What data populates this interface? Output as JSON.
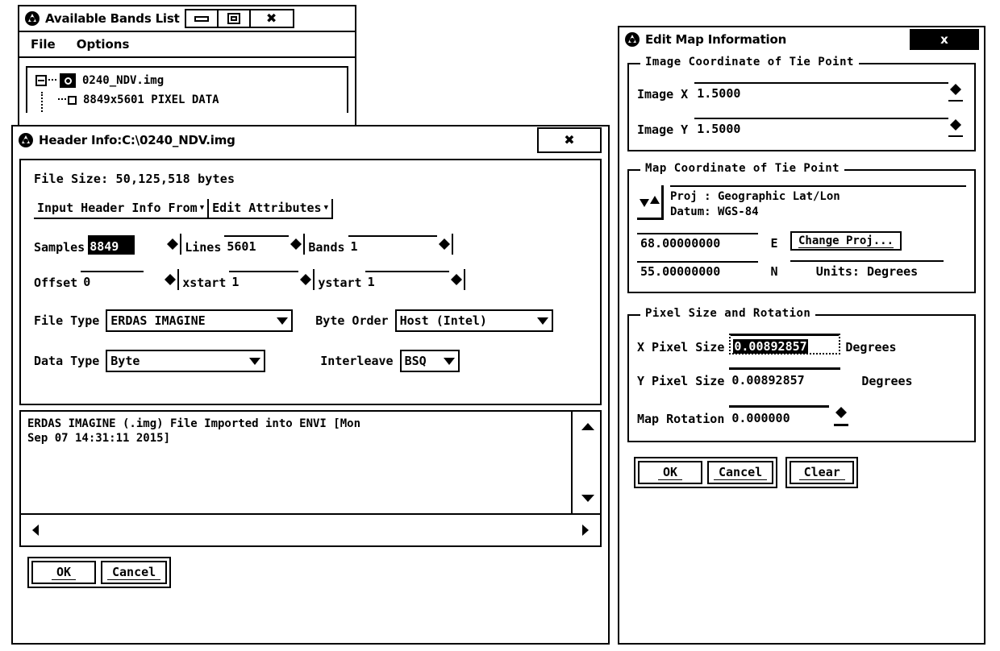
{
  "bands_window": {
    "title": "Available Bands List",
    "logo_icon": "envi-logo-icon",
    "titlebar_buttons": [
      {
        "name": "minimize-button",
        "icon": "minimize-icon"
      },
      {
        "name": "maximize-button",
        "icon": "maximize-icon"
      },
      {
        "name": "close-button",
        "icon": "close-x-icon",
        "label": "✖"
      }
    ],
    "menu": [
      "File",
      "Options"
    ],
    "tree": [
      {
        "label": "0240_NDV.img",
        "level": 0,
        "expander": "collapse-minus-icon",
        "icon": "band-file-icon"
      },
      {
        "label": "8849x5601 PIXEL DATA",
        "level": 1,
        "icon": "band-item-checkbox"
      }
    ]
  },
  "header_window": {
    "title": "Header Info:C:\\0240_NDV.img",
    "logo_icon": "envi-logo-icon",
    "close_label": "✖",
    "file_size": "File Size: 50,125,518 bytes",
    "dropdowns": [
      {
        "label": "Input Header Info From",
        "caret": "▼"
      },
      {
        "label": "Edit Attributes",
        "caret": "▼"
      }
    ],
    "fields": [
      {
        "label": "Samples",
        "value": "8849",
        "selected": true
      },
      {
        "label": "Lines",
        "value": "5601",
        "selected": false
      },
      {
        "label": "Bands",
        "value": "1",
        "selected": false
      },
      {
        "label": "Offset",
        "value": "0",
        "selected": false
      },
      {
        "label": "xstart",
        "value": "1",
        "selected": false
      },
      {
        "label": "ystart",
        "value": "1",
        "selected": false
      }
    ],
    "file_type": {
      "label": "File Type",
      "value": "ERDAS IMAGINE"
    },
    "byte_order": {
      "label": "Byte Order",
      "value": "Host (Intel)"
    },
    "data_type": {
      "label": "Data Type",
      "value": "Byte"
    },
    "interleave": {
      "label": "Interleave",
      "value": "BSQ"
    },
    "description": "ERDAS IMAGINE (.img) File Imported into ENVI [Mon\nSep 07 14:31:11 2015]",
    "buttons": [
      {
        "label": "OK",
        "name": "ok-button"
      },
      {
        "label": "Cancel",
        "name": "cancel-button"
      }
    ]
  },
  "map_window": {
    "title": "Edit Map Information",
    "logo_icon": "envi-logo-icon",
    "close_label": "x",
    "group_image": {
      "legend": "Image Coordinate of Tie Point",
      "fields": [
        {
          "label": "Image X",
          "value": "1.5000"
        },
        {
          "label": "Image Y",
          "value": "1.5000"
        }
      ]
    },
    "group_map": {
      "legend": "Map Coordinate of Tie Point",
      "flip_icon": "up-down-arrows-icon",
      "proj_line1": "Proj : Geographic Lat/Lon",
      "proj_line2": "Datum: WGS-84",
      "easting": "68.00000000",
      "easting_hemi": "E",
      "northing": "55.00000000",
      "northing_hemi": "N",
      "change_proj_label": "Change Proj...",
      "units_label": "Units: Degrees"
    },
    "group_pixel": {
      "legend": "Pixel Size and Rotation",
      "x_pixel": {
        "label": "X Pixel Size",
        "value": "0.00892857",
        "units": "Degrees",
        "selected": true
      },
      "y_pixel": {
        "label": "Y Pixel Size",
        "value": "0.00892857",
        "units": "Degrees",
        "selected": false
      },
      "rotation": {
        "label": "Map Rotation",
        "value": "0.000000"
      }
    },
    "buttons": [
      {
        "label": "OK",
        "name": "ok-button"
      },
      {
        "label": "Cancel",
        "name": "cancel-button"
      },
      {
        "label": "Clear",
        "name": "clear-button"
      }
    ]
  }
}
